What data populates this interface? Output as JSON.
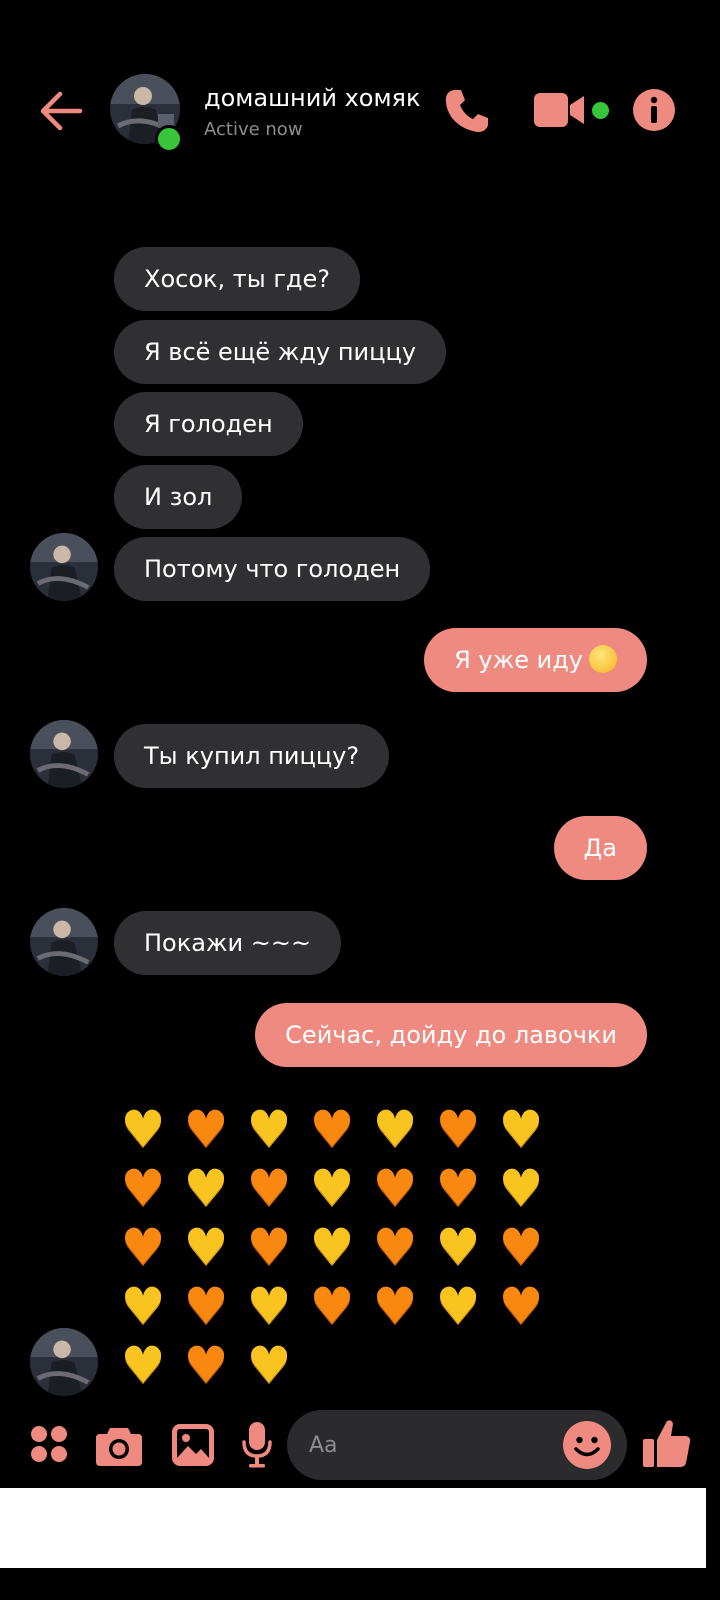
{
  "header": {
    "contact_name": "домашний хомяк",
    "status": "Active now"
  },
  "messages": [
    {
      "dir": "in",
      "text": "Хосок, ты где?"
    },
    {
      "dir": "in",
      "text": "Я всё ещё жду пиццу"
    },
    {
      "dir": "in",
      "text": "Я голоден"
    },
    {
      "dir": "in",
      "text": "И зол"
    },
    {
      "dir": "in",
      "text": "Потому что голоден"
    },
    {
      "dir": "out",
      "text": "Я уже иду",
      "emoji": "rolling-eyes-emoji"
    },
    {
      "dir": "in",
      "text": "Ты купил пиццу?"
    },
    {
      "dir": "out",
      "text": "Да"
    },
    {
      "dir": "in",
      "text": "Покажи ~~~"
    },
    {
      "dir": "out",
      "text": "Сейчас, дойду до лавочки"
    }
  ],
  "hearts_message": {
    "rows": [
      [
        "yellow",
        "orange",
        "yellow",
        "orange",
        "yellow",
        "orange",
        "yellow"
      ],
      [
        "orange",
        "yellow",
        "orange",
        "yellow",
        "orange",
        "orange",
        "yellow"
      ],
      [
        "orange",
        "yellow",
        "orange",
        "yellow",
        "orange",
        "yellow",
        "orange"
      ],
      [
        "yellow",
        "orange",
        "yellow",
        "orange",
        "orange",
        "yellow",
        "orange"
      ],
      [
        "yellow",
        "orange",
        "yellow"
      ]
    ]
  },
  "composer": {
    "placeholder": "Aa"
  },
  "colors": {
    "accent": "#ef8a80",
    "incoming_bubble": "#303033",
    "online": "#38c43b",
    "heart_yellow": "#f9c420",
    "heart_orange": "#f98811"
  },
  "icons": {
    "header": [
      "back-arrow-icon",
      "phone-icon",
      "video-camera-icon",
      "info-icon"
    ],
    "composer": [
      "apps-icon",
      "camera-icon",
      "gallery-icon",
      "microphone-icon",
      "emoji-icon",
      "thumbs-up-icon"
    ]
  }
}
